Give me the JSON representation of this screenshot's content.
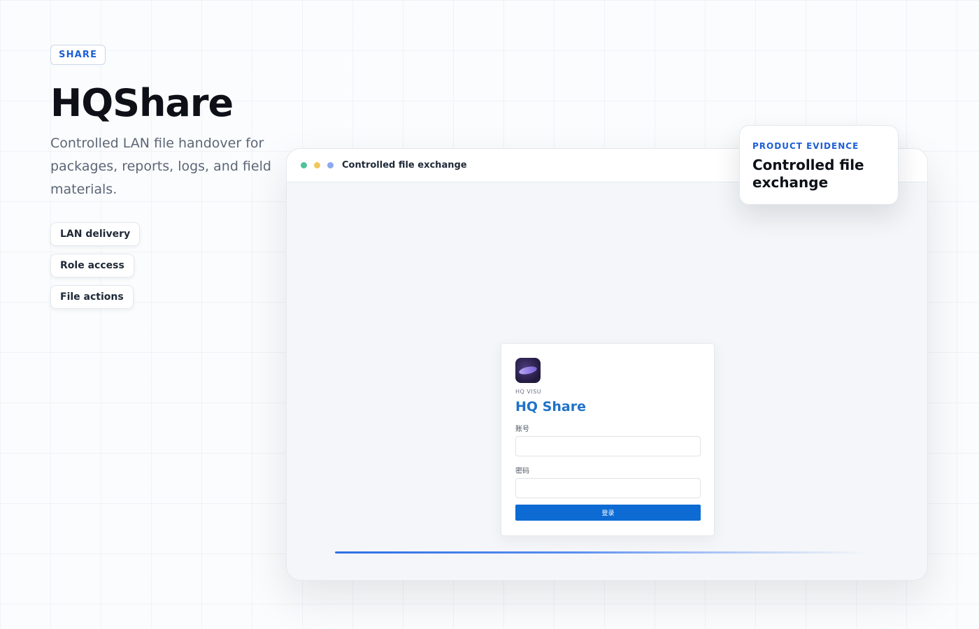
{
  "hero": {
    "eyebrow": "SHARE",
    "title": "HQShare",
    "subtitle": "Controlled LAN file handover for packages, reports, logs, and field materials.",
    "chips": [
      "LAN delivery",
      "Role access",
      "File actions"
    ]
  },
  "window": {
    "title": "Controlled file exchange",
    "dot_colors": [
      "#4fc29a",
      "#efc85a",
      "#8aa9ee"
    ]
  },
  "login": {
    "brand_small": "HQ VISU",
    "brand_title": "HQ Share",
    "account_label": "账号",
    "account_value": "",
    "password_label": "密码",
    "password_value": "",
    "submit_label": "登录"
  },
  "progress": {
    "fraction": 1.0
  },
  "evidence": {
    "eyebrow": "PRODUCT EVIDENCE",
    "title": "Controlled file exchange"
  },
  "colors": {
    "accent": "#1d5fd6",
    "brand_title": "#1f72c9",
    "button": "#0d6bd3"
  }
}
